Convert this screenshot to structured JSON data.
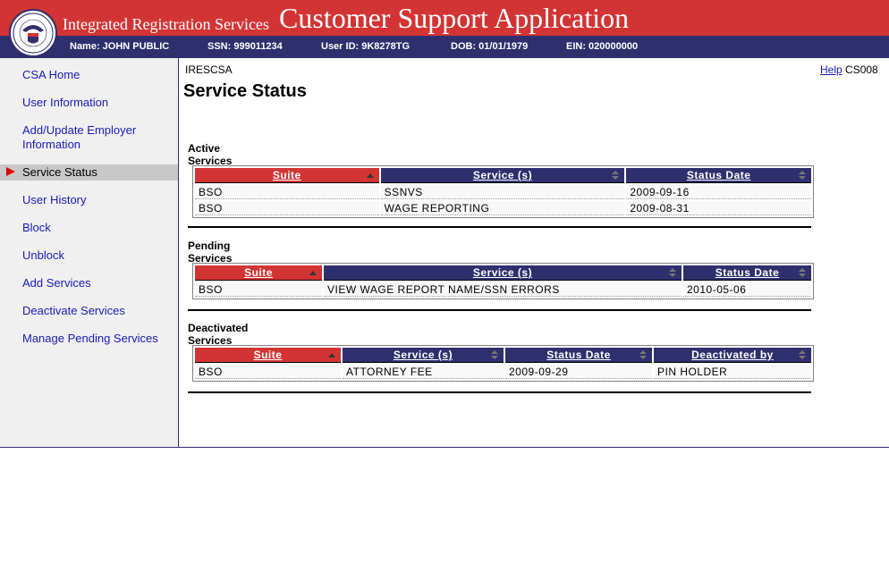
{
  "header": {
    "logo_name": "ssa-seal",
    "logo_text": "SOCIAL SECURITY ADMINISTRATION USA",
    "system_title": "Integrated Registration Services",
    "app_title": "Customer Support Application"
  },
  "user_info": {
    "name": "Name: JOHN PUBLIC",
    "ssn": "SSN: 999011234",
    "user_id": "User ID: 9K8278TG",
    "dob": "DOB: 01/01/1979",
    "ein": "EIN: 020000000"
  },
  "sidebar": {
    "items": [
      {
        "label": "CSA Home"
      },
      {
        "label": "User Information"
      },
      {
        "label": "Add/Update Employer Information"
      },
      {
        "label": "Service Status",
        "active": true
      },
      {
        "label": "User History"
      },
      {
        "label": "Block"
      },
      {
        "label": "Unblock"
      },
      {
        "label": "Add Services"
      },
      {
        "label": "Deactivate Services"
      },
      {
        "label": "Manage Pending Services"
      }
    ]
  },
  "page": {
    "app_id": "IRESCSA",
    "title": "Service Status",
    "help_label": "Help",
    "screen_id": "CS008"
  },
  "active": {
    "title": "Active Services",
    "headers": [
      "Suite",
      "Service (s)",
      "Status Date"
    ],
    "rows": [
      [
        "BSO",
        "SSNVS",
        "2009-09-16"
      ],
      [
        "BSO",
        "WAGE REPORTING",
        "2009-08-31"
      ]
    ]
  },
  "pending": {
    "title": "Pending Services",
    "headers": [
      "Suite",
      "Service (s)",
      "Status Date"
    ],
    "rows": [
      [
        "BSO",
        "VIEW WAGE REPORT NAME/SSN ERRORS",
        "2010-05-06"
      ]
    ]
  },
  "deactivated": {
    "title": "Deactivated Services",
    "headers": [
      "Suite",
      "Service (s)",
      "Status Date",
      "Deactivated by"
    ],
    "rows": [
      [
        "BSO",
        "ATTORNEY FEE",
        "2009-09-29",
        "PIN HOLDER"
      ]
    ]
  },
  "colors": {
    "header_red": "#d23434",
    "header_navy": "#2f2f6e",
    "link_blue": "#1a1ab8"
  }
}
